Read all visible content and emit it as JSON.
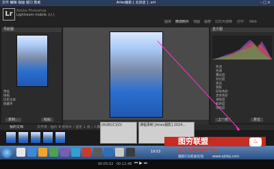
{
  "window": {
    "title": "Arles摄影 [ 北京店 ] .vnt",
    "menu": [
      "文件",
      "编辑",
      "视图",
      "窗口",
      "帮助"
    ]
  },
  "app": {
    "logo": "Lr",
    "name_line1": "Adobe Photoshop",
    "name_line2": "Lightroom mobile 入门"
  },
  "modules": [
    "图库",
    "修改照片",
    "地图",
    "画册",
    "幻灯片放映",
    "打印",
    "Web"
  ],
  "left_panel": {
    "header": "导航器",
    "sections": [
      "预设",
      "快照",
      "历史记录",
      "收藏夹"
    ],
    "buttons": [
      "复制...",
      "粘贴"
    ]
  },
  "right_panel": {
    "header": "直方图",
    "slider_labels": [
      "色温",
      "色调",
      "曝光度",
      "对比度",
      "高光",
      "阴影",
      "白色色阶",
      "黑色色阶",
      "清晰度",
      "鲜艳度",
      "饱和度"
    ],
    "buttons": [
      "上一张",
      "复位"
    ]
  },
  "filmstrip": {
    "label": "我的文档",
    "info": "文件夹 : 图片 9 张照片 / 选定 1 张 / 人像照片.jpg",
    "filter": "过滤器:"
  },
  "taskbar": {
    "task1": "(A)(B)(C)(D)",
    "task2": "课程录制 [Arles摄影] 2024...",
    "time": "19:53"
  },
  "player": {
    "time": "00:05:02",
    "total": "00:12:48"
  },
  "watermark": {
    "brand": "图穷联盟",
    "qq": "QQ:985303259",
    "site_label": "摄影CG资源论坛",
    "url": "www.xjtdsj.com"
  },
  "colors": {
    "brand_red": "#e23a2c",
    "lr_bg": "#222222",
    "accent_blue": "#2a3d5a"
  }
}
